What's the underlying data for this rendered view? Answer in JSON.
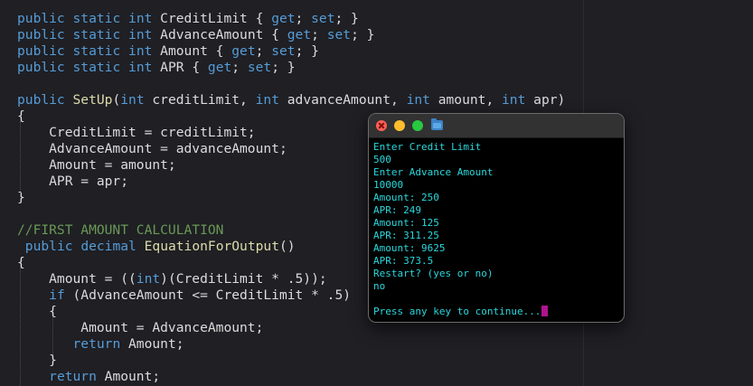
{
  "colors": {
    "editor_background": "#1f1f24",
    "keyword": "#569cd6",
    "function": "#dcdcaa",
    "comment": "#6a9955",
    "plain": "#dcdcdc",
    "terminal_background": "#000000",
    "terminal_text": "#2ad7dc",
    "cursor": "#b0148f"
  },
  "icons": {
    "close": "close-icon",
    "minimize": "minimize-icon",
    "maximize": "maximize-icon",
    "terminal": "folder-icon"
  },
  "editor": {
    "lines": [
      [
        [
          "kw",
          "public"
        ],
        [
          "pl",
          " "
        ],
        [
          "kw",
          "static"
        ],
        [
          "pl",
          " "
        ],
        [
          "kw",
          "int"
        ],
        [
          "pl",
          " CreditLimit { "
        ],
        [
          "kw",
          "get"
        ],
        [
          "pl",
          "; "
        ],
        [
          "kw",
          "set"
        ],
        [
          "pl",
          "; }"
        ]
      ],
      [
        [
          "kw",
          "public"
        ],
        [
          "pl",
          " "
        ],
        [
          "kw",
          "static"
        ],
        [
          "pl",
          " "
        ],
        [
          "kw",
          "int"
        ],
        [
          "pl",
          " AdvanceAmount { "
        ],
        [
          "kw",
          "get"
        ],
        [
          "pl",
          "; "
        ],
        [
          "kw",
          "set"
        ],
        [
          "pl",
          "; }"
        ]
      ],
      [
        [
          "kw",
          "public"
        ],
        [
          "pl",
          " "
        ],
        [
          "kw",
          "static"
        ],
        [
          "pl",
          " "
        ],
        [
          "kw",
          "int"
        ],
        [
          "pl",
          " Amount { "
        ],
        [
          "kw",
          "get"
        ],
        [
          "pl",
          "; "
        ],
        [
          "kw",
          "set"
        ],
        [
          "pl",
          "; }"
        ]
      ],
      [
        [
          "kw",
          "public"
        ],
        [
          "pl",
          " "
        ],
        [
          "kw",
          "static"
        ],
        [
          "pl",
          " "
        ],
        [
          "kw",
          "int"
        ],
        [
          "pl",
          " APR { "
        ],
        [
          "kw",
          "get"
        ],
        [
          "pl",
          "; "
        ],
        [
          "kw",
          "set"
        ],
        [
          "pl",
          "; }"
        ]
      ],
      [],
      [
        [
          "kw",
          "public"
        ],
        [
          "pl",
          " "
        ],
        [
          "fn",
          "SetUp"
        ],
        [
          "pl",
          "("
        ],
        [
          "kw",
          "int"
        ],
        [
          "pl",
          " creditLimit, "
        ],
        [
          "kw",
          "int"
        ],
        [
          "pl",
          " advanceAmount, "
        ],
        [
          "kw",
          "int"
        ],
        [
          "pl",
          " amount, "
        ],
        [
          "kw",
          "int"
        ],
        [
          "pl",
          " apr)"
        ]
      ],
      [
        [
          "pl",
          "{"
        ]
      ],
      [
        [
          "pl",
          "    CreditLimit = creditLimit;"
        ]
      ],
      [
        [
          "pl",
          "    AdvanceAmount = advanceAmount;"
        ]
      ],
      [
        [
          "pl",
          "    Amount = amount;"
        ]
      ],
      [
        [
          "pl",
          "    APR = apr;"
        ]
      ],
      [
        [
          "pl",
          "}"
        ]
      ],
      [],
      [
        [
          "cm",
          "//FIRST AMOUNT CALCULATION"
        ]
      ],
      [
        [
          "pl",
          " "
        ],
        [
          "kw",
          "public"
        ],
        [
          "pl",
          " "
        ],
        [
          "kw",
          "decimal"
        ],
        [
          "pl",
          " "
        ],
        [
          "fn",
          "EquationForOutput"
        ],
        [
          "pl",
          "()"
        ]
      ],
      [
        [
          "pl",
          "{"
        ]
      ],
      [
        [
          "pl",
          "    Amount = (("
        ],
        [
          "kw",
          "int"
        ],
        [
          "pl",
          ")(CreditLimit * .5));"
        ]
      ],
      [
        [
          "pl",
          "    "
        ],
        [
          "kw",
          "if"
        ],
        [
          "pl",
          " (AdvanceAmount <= CreditLimit * .5)"
        ]
      ],
      [
        [
          "pl",
          "    {"
        ]
      ],
      [
        [
          "pl",
          "        Amount = AdvanceAmount;"
        ]
      ],
      [
        [
          "pl",
          "       "
        ],
        [
          "kw",
          "return"
        ],
        [
          "pl",
          " Amount;"
        ]
      ],
      [
        [
          "pl",
          "    }"
        ]
      ],
      [
        [
          "pl",
          "    "
        ],
        [
          "kw",
          "return"
        ],
        [
          "pl",
          " Amount;"
        ]
      ]
    ]
  },
  "terminal": {
    "lines": [
      "Enter Credit Limit",
      "500",
      "Enter Advance Amount",
      "10000",
      "Amount: 250",
      "APR: 249",
      "Amount: 125",
      "APR: 311.25",
      "Amount: 9625",
      "APR: 373.5",
      "Restart? (yes or no)",
      "no",
      "",
      "Press any key to continue..."
    ]
  }
}
